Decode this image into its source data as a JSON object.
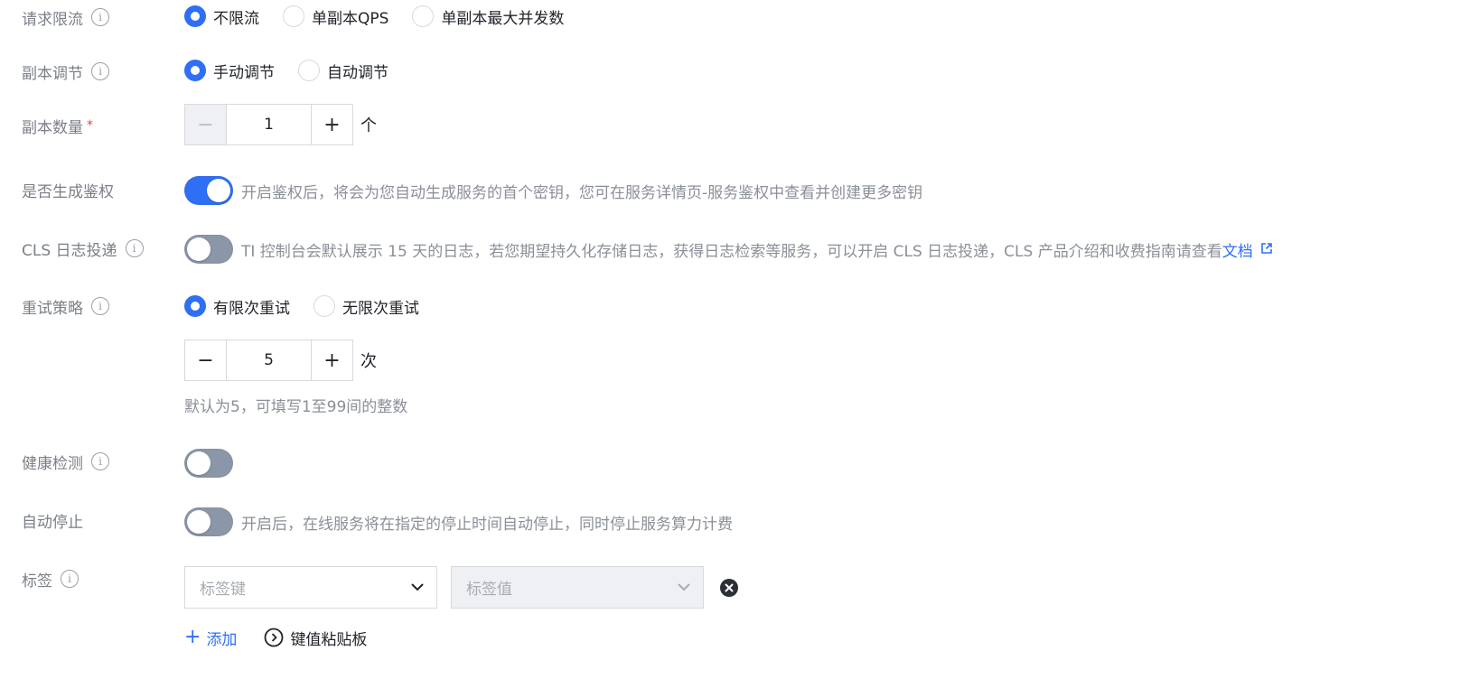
{
  "rate_limit": {
    "label": "请求限流",
    "options": [
      "不限流",
      "单副本QPS",
      "单副本最大并发数"
    ],
    "selected": 0
  },
  "replica_adjust": {
    "label": "副本调节",
    "options": [
      "手动调节",
      "自动调节"
    ],
    "selected": 0
  },
  "replica_count": {
    "label": "副本数量",
    "required_mark": "*",
    "value": "1",
    "unit": "个"
  },
  "auth": {
    "label": "是否生成鉴权",
    "enabled": true,
    "description": "开启鉴权后，将会为您自动生成服务的首个密钥，您可在服务详情页-服务鉴权中查看并创建更多密钥"
  },
  "cls_log": {
    "label": "CLS 日志投递",
    "enabled": false,
    "description": "TI 控制台会默认展示 15 天的日志，若您期望持久化存储日志，获得日志检索等服务，可以开启 CLS 日志投递，CLS 产品介绍和收费指南请查看",
    "link_text": "文档"
  },
  "retry": {
    "label": "重试策略",
    "options": [
      "有限次重试",
      "无限次重试"
    ],
    "selected": 0,
    "count_value": "5",
    "count_unit": "次",
    "hint": "默认为5，可填写1至99间的整数"
  },
  "health_check": {
    "label": "健康检测",
    "enabled": false
  },
  "auto_stop": {
    "label": "自动停止",
    "enabled": false,
    "description": "开启后，在线服务将在指定的停止时间自动停止，同时停止服务算力计费"
  },
  "tags": {
    "label": "标签",
    "key_placeholder": "标签键",
    "value_placeholder": "标签值",
    "add_label": "添加",
    "paste_label": "键值粘贴板"
  },
  "colors": {
    "accent": "#2f6ff5",
    "switch_off": "#8b96a8",
    "label_gray": "#7a7f87",
    "required_red": "#e54545"
  }
}
